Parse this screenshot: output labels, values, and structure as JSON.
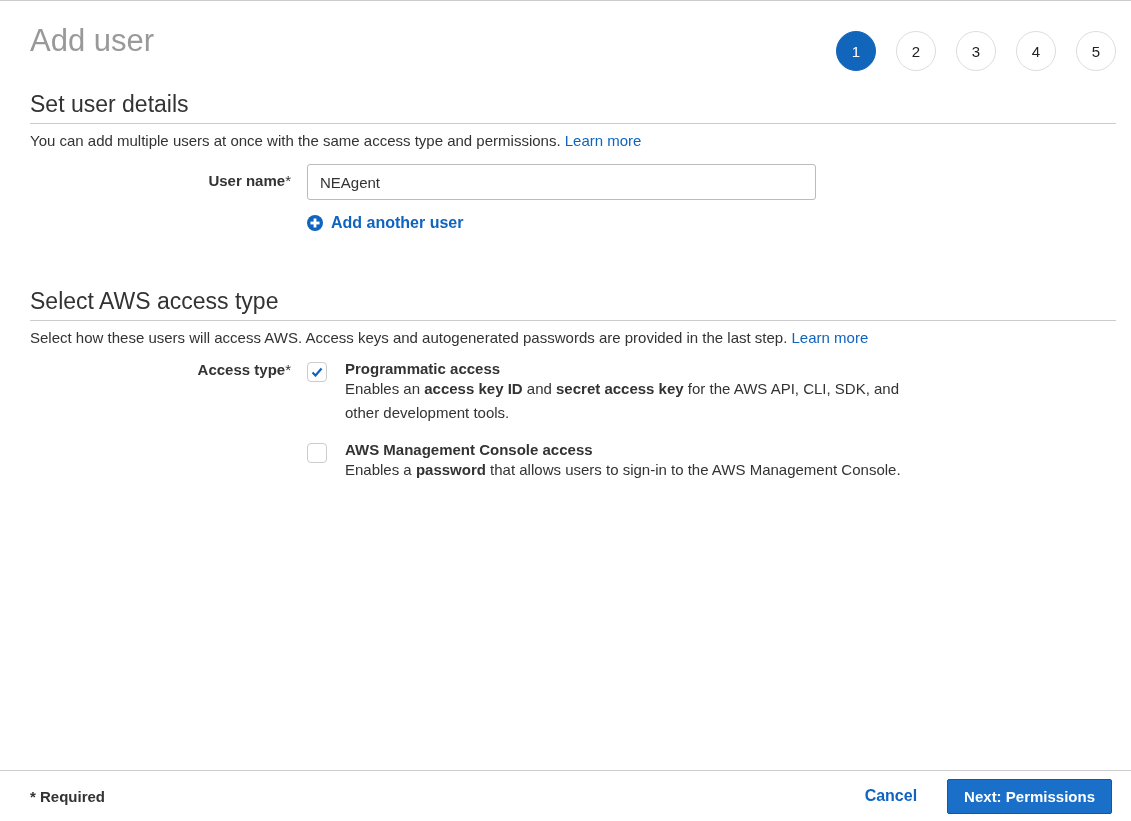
{
  "title": "Add user",
  "steps": [
    {
      "label": "1",
      "selected": true
    },
    {
      "label": "2",
      "selected": false
    },
    {
      "label": "3",
      "selected": false
    },
    {
      "label": "4",
      "selected": false
    },
    {
      "label": "5",
      "selected": false
    }
  ],
  "details": {
    "heading": "Set user details",
    "description": "You can add multiple users at once with the same access type and permissions.",
    "link": "Learn more",
    "user_name": {
      "label": "User name",
      "marker": "*",
      "value": "NEAgent"
    },
    "add_user": "Add another user"
  },
  "access": {
    "heading": "Select AWS access type",
    "description": "Select how these users will access AWS. Access keys and autogenerated passwords are provided in the last step.",
    "link": "Learn more",
    "label": "Access type",
    "marker": "*",
    "options": [
      {
        "title": "Programmatic access",
        "description": "Enables an **access key ID** and **secret access key** for the AWS API, CLI, SDK, and other development tools.",
        "checked": true
      },
      {
        "title": "AWS Management Console access",
        "description": "Enables a **password** that allows users to sign-in to the AWS Management Console.",
        "checked": false
      }
    ]
  },
  "footer": {
    "required_note": "* Required",
    "cancel": "Cancel",
    "next": "Next: Permissions"
  }
}
